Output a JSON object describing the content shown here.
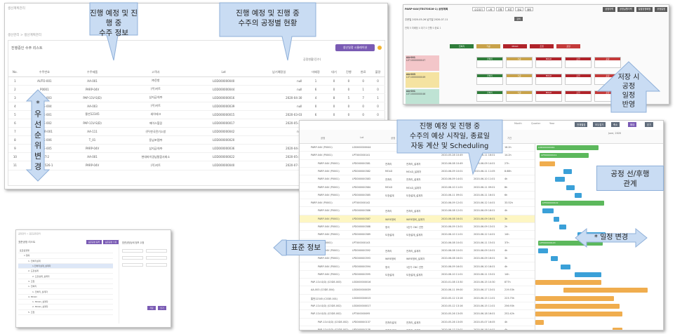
{
  "panel1": {
    "top_title": "생산계획관리",
    "crumb": "생산관리 > 생산계획관리",
    "card_title": "진행중인 수주 리스트",
    "action_label": "생산일정 시뮬레이션",
    "group_header": "공정현황(진수)",
    "columns": [
      "No.",
      "수주번호",
      "수주제품",
      "고객사",
      "Lot",
      "납기예정일",
      "미배정",
      "대기",
      "진행",
      "완료",
      "불량"
    ],
    "rows": [
      [
        "1",
        "AUTO-001",
        "AA-001",
        "㈜운항",
        "LOD000000040",
        "null",
        "1",
        "0",
        "0",
        "0",
        "0"
      ],
      [
        "2",
        "P0001",
        "PARP-04V",
        "(주)키트",
        "LOD000000044",
        "null",
        "6",
        "0",
        "0",
        "1",
        "0"
      ],
      [
        "3",
        "CODE-003",
        "PAP-11V-S(D)",
        "삼지금속㈜",
        "LOD000000016",
        "2020-04-30",
        "4",
        "8",
        "5",
        "7",
        "1"
      ],
      [
        "4",
        "CODE-004",
        "AA-003",
        "(주)키트",
        "LOD000000039",
        "null",
        "0",
        "0",
        "0",
        "0",
        "0"
      ],
      [
        "5",
        "CODE-001",
        "통번12345",
        "세아테크",
        "LOD000000015",
        "2020-03-03",
        "6",
        "0",
        "0",
        "0",
        "0"
      ],
      [
        "6",
        "CODE-002",
        "PAP-11V-S(D)",
        "에이스힐링",
        "LOD000000017",
        "2020-05-31",
        "0",
        "0",
        "0",
        "0",
        "0"
      ],
      [
        "7",
        "ORDER-001",
        "AA-111",
        "(주)한국전기소방",
        "LOD000000042",
        "null",
        "4",
        "0",
        "0",
        "0",
        "0"
      ],
      [
        "8",
        "CODE-006",
        "T_01",
        "동남포럼㈜",
        "LOD000000020",
        "",
        "0",
        "0",
        "0",
        "0",
        "0"
      ],
      [
        "9",
        "CODE-005",
        "PARP-04V",
        "삼지금속㈜",
        "LOD000000036",
        "2020-04-30",
        "0",
        "0",
        "0",
        "0",
        "0"
      ],
      [
        "10",
        "TEST-2",
        "AA-001",
        "현대파이경남통합사회소",
        "LOD000000022",
        "2020-05-27",
        "1",
        "0",
        "0",
        "0",
        "0"
      ],
      [
        "11",
        "TEST0526-1",
        "PARP-04V",
        "(주)키트",
        "LOD000000040",
        "2020-07-11",
        "4",
        "0",
        "0",
        "0",
        "0"
      ]
    ]
  },
  "panel2": {
    "header": "PARP-04V(TEST0526-1) 공정계획",
    "legend": [
      "수주대기",
      "시작",
      "진행",
      "보류",
      "완료",
      "불량"
    ],
    "buttons": [
      "공정이력",
      "공정실행이력",
      "일괄공정배정",
      "공정일정"
    ],
    "row1": "주문일  2020-05-26    납기일  2020-07-11",
    "row1_btn": "검색",
    "row2": "전체   5   미배정   4   대기   0   진행   0   완료   1",
    "process_bars": [
      {
        "label": "전처리",
        "color": "#2f7d3a"
      },
      {
        "label": "가공",
        "color": "#c8a24a"
      },
      {
        "label": "MOLD",
        "color": "#b0232a"
      },
      {
        "label": "조립",
        "color": "#b0232a"
      },
      {
        "label": "포장",
        "color": "#c43a3a"
      }
    ],
    "orders": [
      {
        "id": "AA-001",
        "lot": "LOT-0000000047",
        "color": "#f3c6c9"
      },
      {
        "id": "AA-003",
        "lot": "LOT-0000000049",
        "color": "#f5e3a1"
      },
      {
        "id": "AA-001",
        "lot": "LOT-0000000046",
        "color": "#bfe3d4"
      }
    ]
  },
  "panel3": {
    "header": "공정관리 > 표준공정관리",
    "list_title": "표준공정 리스트",
    "btn1": "표준공정 등록",
    "btn2": "표준공정 수정",
    "detail_title": "표준공정상세 정보 수정",
    "tree": [
      "표준공정명",
      "1 절곡",
      "1. 전처리설계",
      "1.전처리설계_설계자",
      "2. 도장설계",
      "2. 도장설계_설계자",
      "3. 조립",
      "1. 전처리",
      "1. 전처리_설계자",
      "4. MOLD",
      "1. MOLD_설계자",
      "2. MOLD_설계자",
      "5. 조립"
    ],
    "save": "저장",
    "close": "닫기"
  },
  "panel4": {
    "toolbar": [
      "Month",
      "Quarter",
      "Year",
      "전체펼침",
      "모두접기",
      "축소",
      "확대",
      "닫기"
    ],
    "timeline_label": "June, 2020",
    "columns": [
      "공정",
      "Lot",
      "공정",
      "작업자",
      "시작일",
      "종료일",
      "기간"
    ],
    "rows": [
      [
        "PARP-04V (P0001)",
        "LOD000000044",
        "",
        "",
        "2020-05-28 10:43",
        "2020-06-14 14:11",
        "16.2h"
      ],
      [
        "PARP-04V (P0001)",
        "LPT000000141",
        "",
        "",
        "2020-05-28 10:49",
        "2020-06-11 16:01",
        "14.2h"
      ],
      [
        "PARP-04V (P0001)",
        "LPD000000381",
        "전처리",
        "전처리_설계자",
        "2020-06-08 10:49",
        "2020-06-09 14:01",
        "27h"
      ],
      [
        "PARP-04V (P0001)",
        "LPD000000382",
        "MOLD",
        "MOLD_설계자",
        "2020-06-09 10:01",
        "2020-06-11 11:05",
        "8.68h"
      ],
      [
        "PARP-04V (P0001)",
        "LPD000000383",
        "전처리",
        "전처리_설계자",
        "2020-06-09 14:01",
        "2020-06-10 11:01",
        "4h"
      ],
      [
        "PARP-04V (P0001)",
        "LPD000000384",
        "MOLD",
        "MOLD_설계자",
        "2020-06-10 11:01",
        "2020-06-11 09:01",
        "8h"
      ],
      [
        "PARP-04V (P0001)",
        "LPD000000385",
        "도장설계",
        "도장설계_설계자",
        "2020-06-11 09:01",
        "2020-06-11 16:01",
        "6h"
      ],
      [
        "PARP-04V (P0001)",
        "LPT000000142",
        "",
        "",
        "2020-06-09 12:01",
        "2020-06-12 14:01",
        "33.52h"
      ],
      [
        "PARP-04V (P0001)",
        "LPD000000386",
        "전처리",
        "전처리_설계자",
        "2020-06-08 12:01",
        "2020-06-09 16:01",
        "4h"
      ],
      [
        "PARP-04V (P0001)",
        "LPD000000387",
        "WIRE정비",
        "WIRE정비_설계자",
        "2020-06-08 16:01",
        "2020-06-09 16:01",
        "3h"
      ],
      [
        "PARP-04V (P0001)",
        "LPD000000388",
        "정삭",
        "1호기 CNC 선반",
        "2020-06-09 13:01",
        "2020-06-09 13:01",
        "2h"
      ],
      [
        "PARP-04V (P0001)",
        "LPD000000389",
        "도장설계",
        "도장설계_설계자",
        "2020-06-10 11:01",
        "2020-06-12 14:01",
        "14h"
      ],
      [
        "PARP-04V (P0001)",
        "LPT000000143",
        "",
        "",
        "2020-06-08 10:01",
        "2020-06-11 15:01",
        "37h"
      ],
      [
        "PARP-04V (P0001)",
        "LPD000000392",
        "전처리",
        "전처리_설계자",
        "2020-06-08 10:01",
        "2020-06-09 10:01",
        "4h"
      ],
      [
        "PARP-04V (P0001)",
        "LPD000000393",
        "WIRE정비",
        "WIRE정비_설계자",
        "2020-06-08 16:01",
        "2020-06-09 16:01",
        "3h"
      ],
      [
        "PARP-04V (P0001)",
        "LPD000000394",
        "정삭",
        "1호기 CNC 선반",
        "2020-06-09 16:01",
        "2020-06-10 16:01",
        "4h"
      ],
      [
        "PARP-04V (P0001)",
        "LPD000000395",
        "도장설계",
        "도장설계_설계자",
        "2020-06-10 11:01",
        "2020-06-11 15:01",
        "14h"
      ],
      [
        "PAP-11V-S(D) (CODE-003)",
        "LOD000000016",
        "",
        "",
        "2020-01-08 13:30",
        "2020-06-15 10:30",
        "877h"
      ],
      [
        "AA-003 (CODE-004)",
        "LOD000000039",
        "",
        "",
        "2020-06-11 09:00",
        "2020-06-17 13:01",
        "219.53h"
      ],
      [
        "통번12345 (CODE-001)",
        "LOD000000015",
        "",
        "",
        "2020-05-12 13:16",
        "2020-06-15 11:01",
        "223.75h"
      ],
      [
        "PAP-11V-S(D) (CODE-002)",
        "LOD000000017",
        "",
        "",
        "2020-05-12 13:16",
        "2020-06-15 11:01",
        "256.93h"
      ],
      [
        "PAP-11V-S(D) (CODE-002)",
        "LPT000000095",
        "",
        "",
        "2020-05-26 13:05",
        "2020-06-18 16:01",
        "252.42h"
      ],
      [
        "PAP-11V-S(D) (CODE-002)",
        "LPD000000137",
        "전처리설계",
        "전처리_설계자",
        "2020-05-26 13:05",
        "2020-05-07 16:05",
        "4h"
      ],
      [
        "PAP-11V-S(D) (CODE-002)",
        "LPD000000138",
        "전처리설계",
        "전처리_설계자",
        "2020-06-17 15:01",
        "2020-06-18 14:01",
        "4h"
      ]
    ],
    "bar_labels": [
      "LOD000000044",
      "LPT000000141",
      "LPT000000142",
      "LPT000000143"
    ]
  },
  "callouts": {
    "order_info": [
      "진행 예정 및 진행 중",
      "수주 정보"
    ],
    "process_status": [
      "진행 예정 및 진행 중",
      "수주의 공정별 현황"
    ],
    "priority_chars": [
      "우",
      "선",
      "순",
      "위",
      "변",
      "경"
    ],
    "priority_mark": "*",
    "save_schedule": [
      "저장 시",
      "공정",
      "일정",
      "반영"
    ],
    "auto_schedule": [
      "진행 예정 및 진행 중",
      "수주의 예상 시작일, 종료일",
      "자동 계산 및 Scheduling"
    ],
    "process_relation": [
      "공정 선/후행",
      "관계"
    ],
    "standard_info": "표준 정보",
    "schedule_change": "* 일정 변경"
  }
}
